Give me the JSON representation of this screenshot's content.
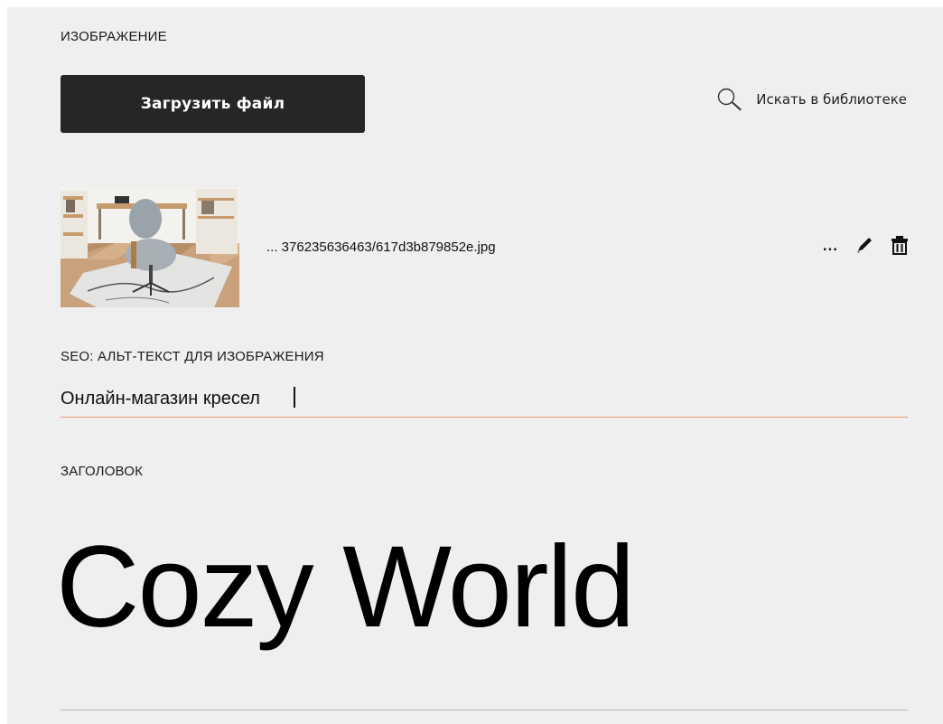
{
  "image_section": {
    "label": "ИЗОБРАЖЕНИЕ",
    "upload_button": "Загрузить файл",
    "search_library": "Искать в библиотеке",
    "search_icon": "search-icon",
    "file": {
      "name": "... 376235636463/617d3b879852e.jpg",
      "more_label": "...",
      "edit_icon": "pencil-icon",
      "delete_icon": "trash-icon"
    }
  },
  "seo_section": {
    "label": "SEO: АЛЬТ-ТЕКСТ ДЛЯ ИЗОБРАЖЕНИЯ",
    "value": "Онлайн-магазин кресел"
  },
  "heading_section": {
    "label": "ЗАГОЛОВОК",
    "value": "Cozy World"
  },
  "colors": {
    "button_bg": "#262626",
    "panel_bg": "#efefef",
    "active_underline": "#ef9a77"
  }
}
